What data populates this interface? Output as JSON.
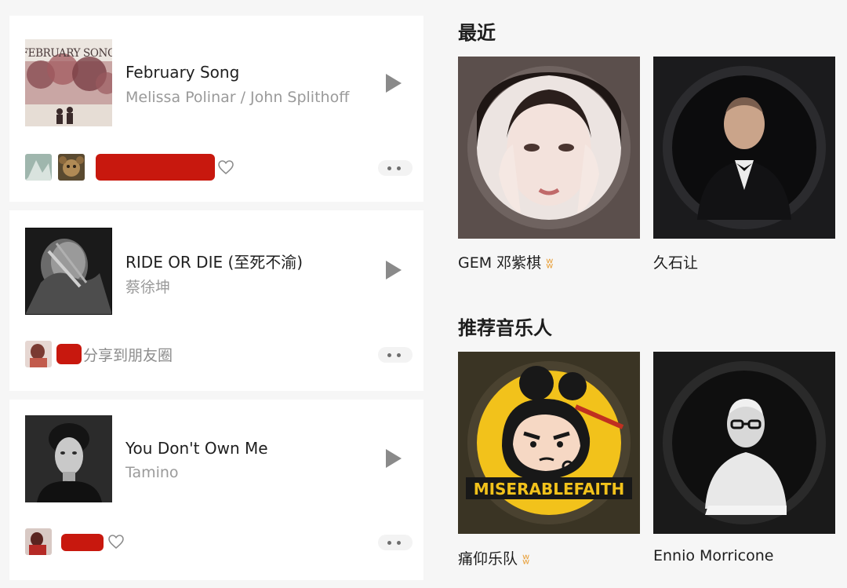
{
  "songs": [
    {
      "title": "February Song",
      "artist": "Melissa Polinar / John Splithoff",
      "cover_text": "FEBRUARY SONG",
      "share_text": ""
    },
    {
      "title": "RIDE OR DIE (至死不渝)",
      "artist": "蔡徐坤",
      "cover_text": "",
      "share_text": "分享到朋友圈"
    },
    {
      "title": "You Don't Own Me",
      "artist": "Tamino",
      "cover_text": "",
      "share_text": ""
    }
  ],
  "recent": {
    "title": "最近",
    "artists": [
      {
        "name": "GEM 邓紫棋",
        "badge": "verified-badge-icon"
      },
      {
        "name": "久石让",
        "badge": ""
      }
    ]
  },
  "recommended": {
    "title": "推荐音乐人",
    "artists": [
      {
        "name": "痛仰乐队",
        "badge": "verified-badge-icon",
        "art_text": "MISERABLEFAITH"
      },
      {
        "name": "Ennio Morricone",
        "badge": ""
      }
    ]
  },
  "colors": {
    "redaction": "#c8180e",
    "badge": "#e8a03a",
    "secondary_text": "#9a9a9a"
  }
}
